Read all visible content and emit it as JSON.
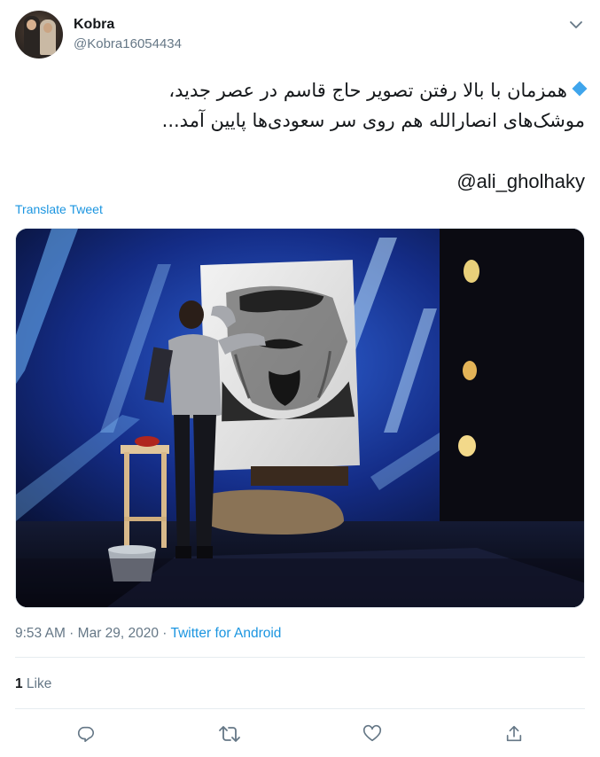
{
  "user": {
    "name": "Kobra",
    "handle": "@Kobra16054434"
  },
  "tweet": {
    "line1": "همزمان با بالا رفتن تصویر حاج قاسم در عصر جدید،",
    "line2": "موشک‌های انصارالله هم روی سر سعودی‌ها پایین آمد...",
    "mention": "@ali_gholhaky",
    "translate_label": "Translate Tweet"
  },
  "meta": {
    "time": "9:53 AM",
    "separator": " · ",
    "date": "Mar 29, 2020",
    "source": "Twitter for Android"
  },
  "stats": {
    "like_count": "1",
    "like_label": " Like"
  },
  "icons": {
    "caret": "chevron-down-icon",
    "reply": "reply-icon",
    "retweet": "retweet-icon",
    "like": "heart-icon",
    "share": "share-icon"
  },
  "colors": {
    "link": "#1b95e0",
    "secondary_text": "#657786",
    "bullet": "#3fa5ec"
  }
}
